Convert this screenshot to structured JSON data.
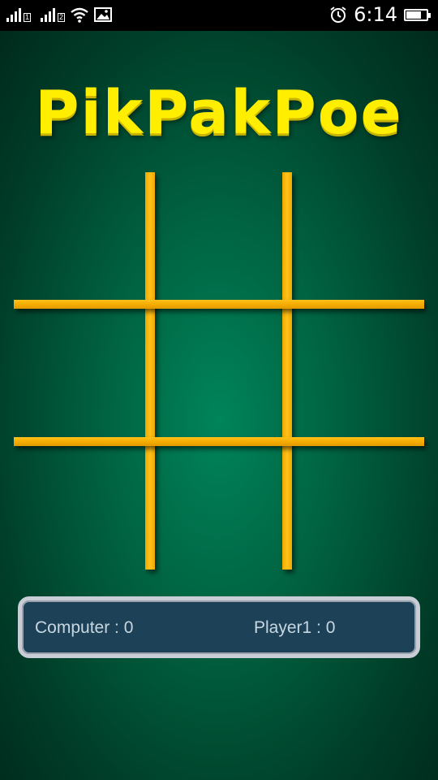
{
  "status_bar": {
    "sim1": "1",
    "sim2": "2",
    "time": "6:14",
    "battery_level": 0.75,
    "icons": [
      "signal-icon",
      "signal-icon",
      "wifi-icon",
      "image-icon",
      "alarm-icon",
      "battery-icon"
    ]
  },
  "game": {
    "title": "PikPakPoe",
    "title_color": "#ffee00",
    "grid_color": "#f5ac00",
    "board": [
      "",
      "",
      "",
      "",
      "",
      "",
      "",
      "",
      ""
    ],
    "score": {
      "computer_label": "Computer : 0",
      "player_label": "Player1 : 0"
    }
  }
}
